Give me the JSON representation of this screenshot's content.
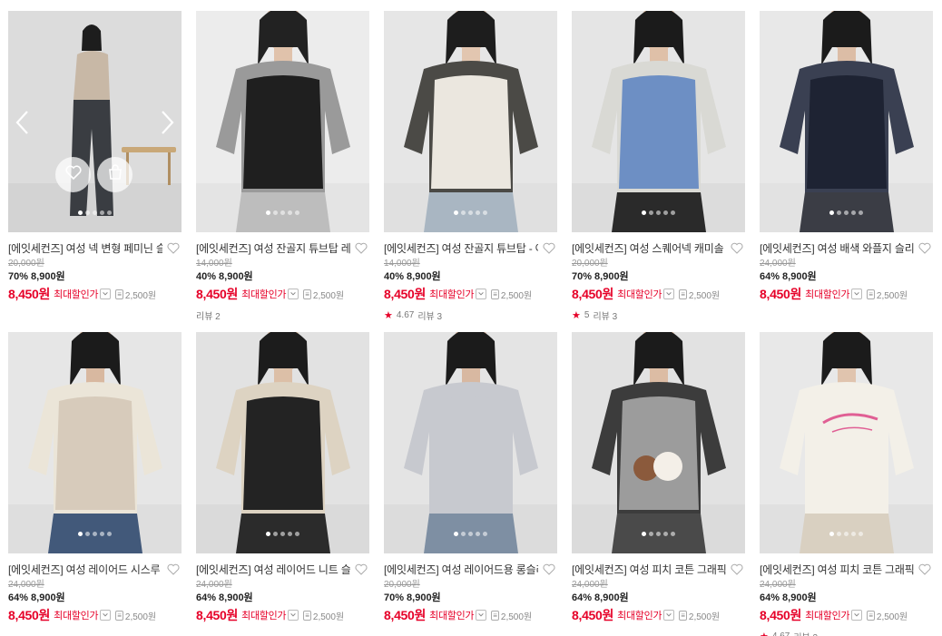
{
  "products": [
    {
      "title": "[에잇세컨즈] 여성 넥 변형 페미닌 슬리브리스 - 베이지",
      "original_price": "20,000원",
      "discount": "70%",
      "price": "8,900원",
      "final_price": "8,450원",
      "final_label": "최대할인가",
      "coupon": "2,500원",
      "rating": "",
      "review": "",
      "image": "beige-top",
      "hover": true
    },
    {
      "title": "[에잇세컨즈] 여성 잔골지 튜브탑 레이어드 티셔츠",
      "original_price": "14,000원",
      "discount": "40%",
      "price": "8,900원",
      "final_price": "8,450원",
      "final_label": "최대할인가",
      "coupon": "2,500원",
      "rating": "",
      "review": "리뷰 2",
      "image": "black-tube-grey-tee"
    },
    {
      "title": "[에잇세컨즈] 여성 잔골지 튜브탑 - 아이보리",
      "original_price": "14,000원",
      "discount": "40%",
      "price": "8,900원",
      "final_price": "8,450원",
      "final_label": "최대할인가",
      "coupon": "2,500원",
      "rating": "4.67",
      "review": "리뷰 3",
      "image": "ivory-tube-scarf"
    },
    {
      "title": "[에잇세컨즈] 여성 스퀘어넥 캐미솔 - 블루",
      "original_price": "20,000원",
      "discount": "70%",
      "price": "8,900원",
      "final_price": "8,450원",
      "final_label": "최대할인가",
      "coupon": "2,500원",
      "rating": "5",
      "review": "리뷰 3",
      "image": "blue-cami"
    },
    {
      "title": "[에잇세컨즈] 여성 배색 와플지 슬리브리스",
      "original_price": "24,000원",
      "discount": "64%",
      "price": "8,900원",
      "final_price": "8,450원",
      "final_label": "최대할인가",
      "coupon": "2,500원",
      "rating": "",
      "review": "",
      "image": "navy-waffle"
    },
    {
      "title": "[에잇세컨즈] 여성 레이어드 시스루 티셔츠",
      "original_price": "24,000원",
      "discount": "64%",
      "price": "8,900원",
      "final_price": "8,450원",
      "final_label": "최대할인가",
      "coupon": "2,500원",
      "rating": "",
      "review": "",
      "image": "sheer-beige"
    },
    {
      "title": "[에잇세컨즈] 여성 레이어드 니트 슬리브리스",
      "original_price": "24,000원",
      "discount": "64%",
      "price": "8,900원",
      "final_price": "8,450원",
      "final_label": "최대할인가",
      "coupon": "2,500원",
      "rating": "",
      "review": "",
      "image": "black-knit-layer"
    },
    {
      "title": "[에잇세컨즈] 여성 레이어드용 롱슬리브 티셔츠",
      "original_price": "20,000원",
      "discount": "70%",
      "price": "8,900원",
      "final_price": "8,450원",
      "final_label": "최대할인가",
      "coupon": "2,500원",
      "rating": "",
      "review": "",
      "image": "grey-longsleeve"
    },
    {
      "title": "[에잇세컨즈] 여성 피치 코튼 그래픽 티셔츠",
      "original_price": "24,000원",
      "discount": "64%",
      "price": "8,900원",
      "final_price": "8,450원",
      "final_label": "최대할인가",
      "coupon": "2,500원",
      "rating": "",
      "review": "",
      "image": "grey-graphic-tee"
    },
    {
      "title": "[에잇세컨즈] 여성 피치 코튼 그래픽 티셔츠 - 아이보리",
      "original_price": "24,000원",
      "discount": "64%",
      "price": "8,900원",
      "final_price": "8,450원",
      "final_label": "최대할인가",
      "coupon": "2,500원",
      "rating": "4.67",
      "review": "리뷰 3",
      "image": "ivory-graphic-tee"
    }
  ],
  "colors": {
    "sale_red": "#e60028",
    "text_muted": "#999999"
  },
  "icons": [
    "heart-icon",
    "bag-icon",
    "chevron-left-icon",
    "chevron-right-icon",
    "chevron-down-icon",
    "coupon-icon",
    "star-icon"
  ]
}
